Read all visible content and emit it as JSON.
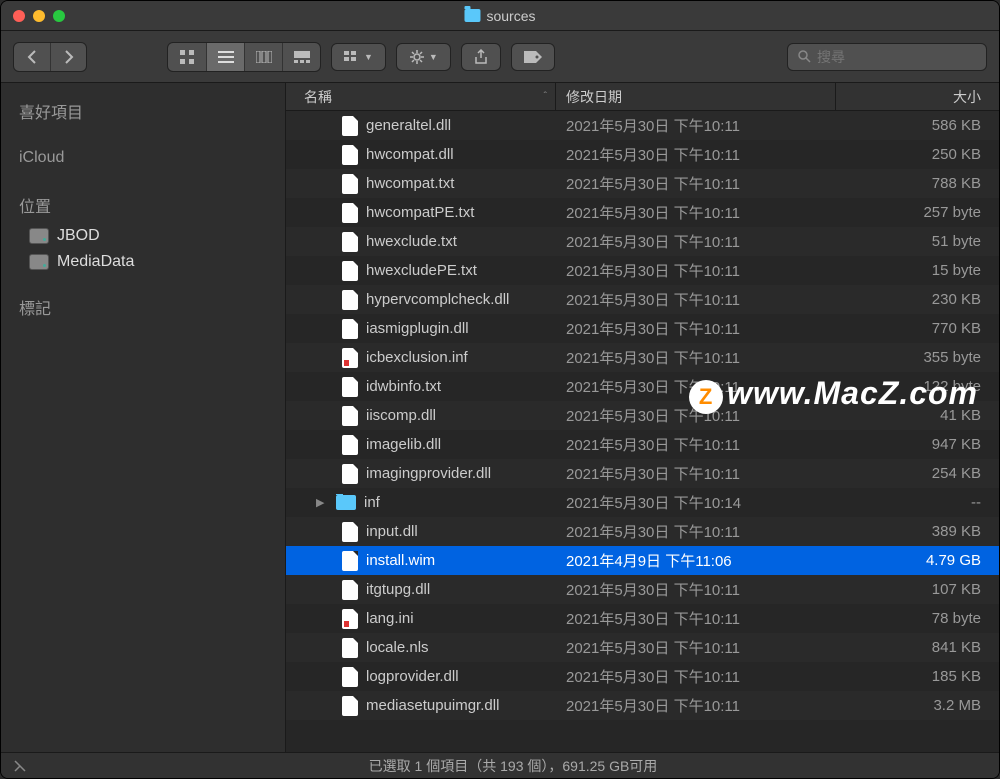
{
  "window": {
    "title": "sources"
  },
  "search": {
    "placeholder": "搜尋"
  },
  "sidebar": {
    "sections": [
      {
        "label": "喜好項目"
      },
      {
        "label": "iCloud"
      },
      {
        "label": "位置",
        "items": [
          {
            "label": "JBOD"
          },
          {
            "label": "MediaData"
          }
        ]
      },
      {
        "label": "標記"
      }
    ]
  },
  "columns": {
    "name": "名稱",
    "date": "修改日期",
    "size": "大小"
  },
  "files": [
    {
      "name": "generaltel.dll",
      "date": "2021年5月30日 下午10:11",
      "size": "586 KB",
      "type": "file"
    },
    {
      "name": "hwcompat.dll",
      "date": "2021年5月30日 下午10:11",
      "size": "250 KB",
      "type": "file"
    },
    {
      "name": "hwcompat.txt",
      "date": "2021年5月30日 下午10:11",
      "size": "788 KB",
      "type": "file"
    },
    {
      "name": "hwcompatPE.txt",
      "date": "2021年5月30日 下午10:11",
      "size": "257 byte",
      "type": "file"
    },
    {
      "name": "hwexclude.txt",
      "date": "2021年5月30日 下午10:11",
      "size": "51 byte",
      "type": "file"
    },
    {
      "name": "hwexcludePE.txt",
      "date": "2021年5月30日 下午10:11",
      "size": "15 byte",
      "type": "file"
    },
    {
      "name": "hypervcomplcheck.dll",
      "date": "2021年5月30日 下午10:11",
      "size": "230 KB",
      "type": "file"
    },
    {
      "name": "iasmigplugin.dll",
      "date": "2021年5月30日 下午10:11",
      "size": "770 KB",
      "type": "file"
    },
    {
      "name": "icbexclusion.inf",
      "date": "2021年5月30日 下午10:11",
      "size": "355 byte",
      "type": "inf"
    },
    {
      "name": "idwbinfo.txt",
      "date": "2021年5月30日 下午10:11",
      "size": "122 byte",
      "type": "file"
    },
    {
      "name": "iiscomp.dll",
      "date": "2021年5月30日 下午10:11",
      "size": "41 KB",
      "type": "file"
    },
    {
      "name": "imagelib.dll",
      "date": "2021年5月30日 下午10:11",
      "size": "947 KB",
      "type": "file"
    },
    {
      "name": "imagingprovider.dll",
      "date": "2021年5月30日 下午10:11",
      "size": "254 KB",
      "type": "file"
    },
    {
      "name": "inf",
      "date": "2021年5月30日 下午10:14",
      "size": "--",
      "type": "folder"
    },
    {
      "name": "input.dll",
      "date": "2021年5月30日 下午10:11",
      "size": "389 KB",
      "type": "file"
    },
    {
      "name": "install.wim",
      "date": "2021年4月9日 下午11:06",
      "size": "4.79 GB",
      "type": "file",
      "selected": true
    },
    {
      "name": "itgtupg.dll",
      "date": "2021年5月30日 下午10:11",
      "size": "107 KB",
      "type": "file"
    },
    {
      "name": "lang.ini",
      "date": "2021年5月30日 下午10:11",
      "size": "78 byte",
      "type": "inf"
    },
    {
      "name": "locale.nls",
      "date": "2021年5月30日 下午10:11",
      "size": "841 KB",
      "type": "file"
    },
    {
      "name": "logprovider.dll",
      "date": "2021年5月30日 下午10:11",
      "size": "185 KB",
      "type": "file"
    },
    {
      "name": "mediasetupuimgr.dll",
      "date": "2021年5月30日 下午10:11",
      "size": "3.2 MB",
      "type": "file"
    }
  ],
  "status": {
    "text": "已選取 1 個項目（共 193 個），691.25 GB可用"
  },
  "watermark": "www.MacZ.com"
}
